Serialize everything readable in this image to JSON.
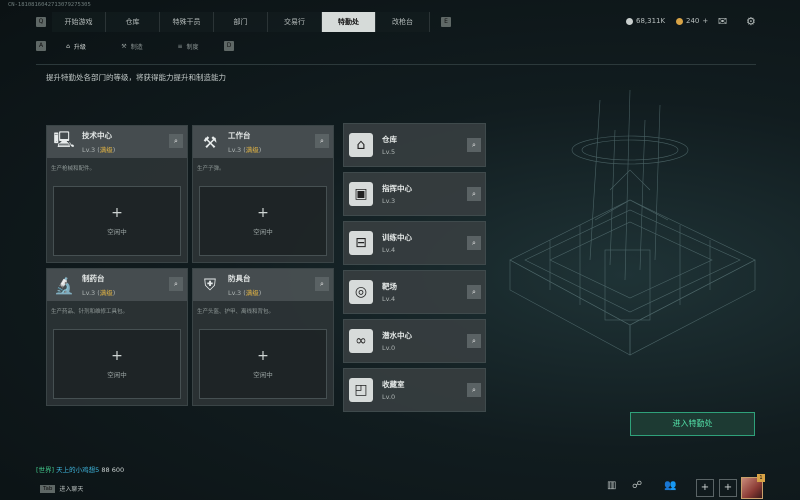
{
  "uid": "CN-1810816042713079275305",
  "nav": {
    "left_key": "Q",
    "right_key": "E",
    "tabs": [
      "开始游戏",
      "仓库",
      "特殊干员",
      "部门",
      "交易行",
      "特勤处",
      "改枪台"
    ],
    "active_index": 5
  },
  "resources": {
    "currency1": "68,311K",
    "currency2": "240",
    "currency2_plus": "+"
  },
  "subtabs": {
    "left_key": "A",
    "right_key": "D",
    "items": [
      {
        "label": "升级",
        "active": true
      },
      {
        "label": "制造",
        "active": false
      },
      {
        "label": "制度",
        "active": false
      }
    ]
  },
  "description": "提升特勤处各部门的等级，将获得能力提升和制造能力",
  "big_cards": [
    {
      "name": "技术中心",
      "lv": "Lv.3",
      "state": "满级",
      "desc": "生产枪械和配件。",
      "slot": "空闲中",
      "icon": "computer-icon"
    },
    {
      "name": "工作台",
      "lv": "Lv.3",
      "state": "满级",
      "desc": "生产子弹。",
      "slot": "空闲中",
      "icon": "hammer-wrench-icon"
    },
    {
      "name": "制药台",
      "lv": "Lv.3",
      "state": "满级",
      "desc": "生产药品、针剂和维修工具包。",
      "slot": "空闲中",
      "icon": "microscope-icon"
    },
    {
      "name": "防具台",
      "lv": "Lv.3",
      "state": "满级",
      "desc": "生产头盔、护甲、离线和背包。",
      "slot": "空闲中",
      "icon": "armor-icon"
    }
  ],
  "small_cards": [
    {
      "name": "仓库",
      "lv": "Lv.5",
      "icon": "warehouse-icon"
    },
    {
      "name": "指挥中心",
      "lv": "Lv.3",
      "icon": "chip-icon"
    },
    {
      "name": "训练中心",
      "lv": "Lv.4",
      "icon": "dumbbell-icon"
    },
    {
      "name": "靶场",
      "lv": "Lv.4",
      "icon": "target-icon"
    },
    {
      "name": "潜水中心",
      "lv": "Lv.0",
      "icon": "diving-goggles-icon"
    },
    {
      "name": "收藏室",
      "lv": "Lv.0",
      "icon": "collection-icon"
    }
  ],
  "enter_button": "进入特勤处",
  "chat": {
    "channel": "[世界]",
    "user": "天上的小鸡想5",
    "message": "88  600"
  },
  "tab_hint": {
    "key": "Tab",
    "label": "进入聊天"
  },
  "colors": {
    "accent_green": "#2fa17a",
    "max_level": "#e2b444"
  }
}
